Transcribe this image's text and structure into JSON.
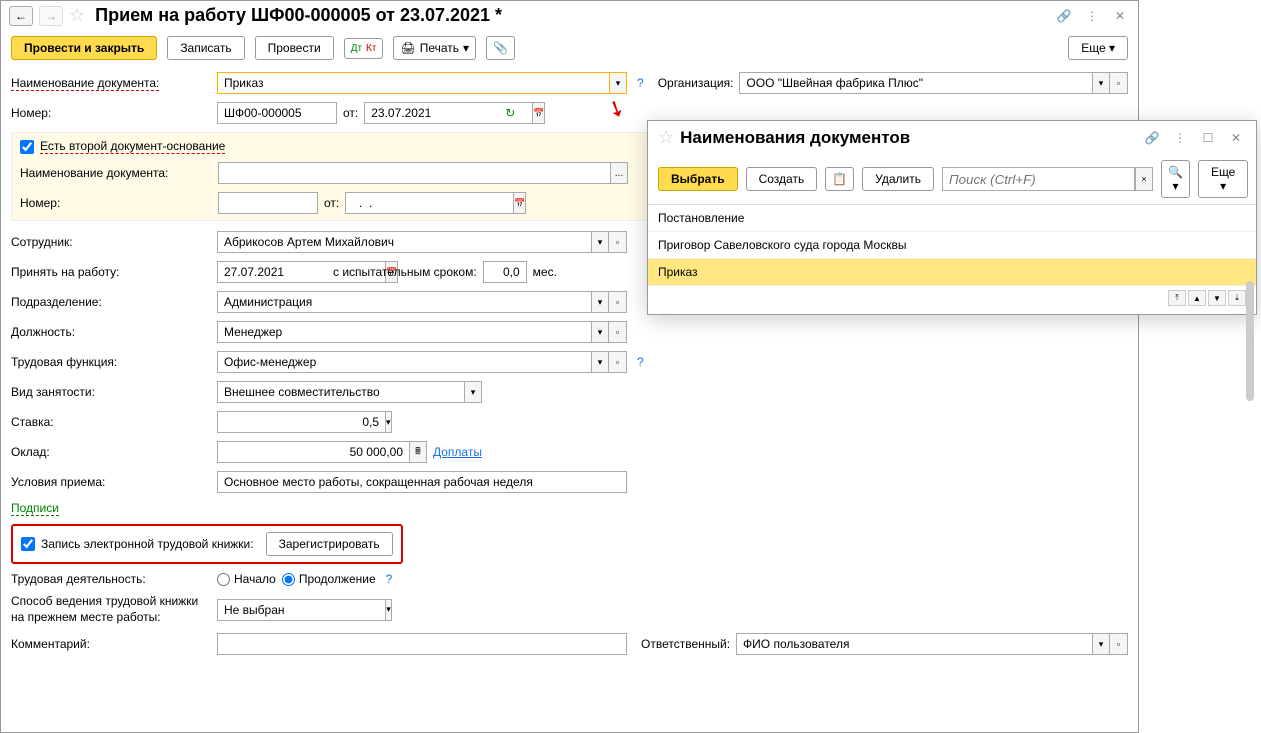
{
  "main": {
    "title": "Прием на работу ШФ00-000005 от 23.07.2021 *",
    "toolbar": {
      "post_close": "Провести и закрыть",
      "save": "Записать",
      "post": "Провести",
      "print": "Печать",
      "more": "Еще"
    },
    "labels": {
      "doc_name": "Наименование документа:",
      "number": "Номер:",
      "from": "от:",
      "org": "Организация:",
      "second_doc": "Есть второй документ-основание",
      "doc_name2": "Наименование документа:",
      "number2": "Номер:",
      "from2": "от:",
      "employee": "Сотрудник:",
      "hire_date": "Принять на работу:",
      "probation": "с испытательным сроком:",
      "months": "мес.",
      "department": "Подразделение:",
      "position": "Должность:",
      "job_function": "Трудовая функция:",
      "employment_type": "Вид занятости:",
      "rate": "Ставка:",
      "salary": "Оклад:",
      "allowances": "Доплаты",
      "conditions": "Условия приема:",
      "signatures": "Подписи",
      "etk_record": "Запись электронной трудовой книжки:",
      "register": "Зарегистрировать",
      "activity": "Трудовая деятельность:",
      "activity_start": "Начало",
      "activity_continue": "Продолжение",
      "book_method": "Способ ведения трудовой книжки на прежнем месте работы:",
      "comment": "Комментарий:",
      "responsible": "Ответственный:"
    },
    "values": {
      "doc_name": "Приказ",
      "number": "ШФ00-000005",
      "date": "23.07.2021",
      "org": "ООО \"Швейная фабрика Плюс\"",
      "doc_name2": "",
      "number2": "",
      "date2": "  .  .    ",
      "employee": "Абрикосов Артем Михайлович",
      "hire_date": "27.07.2021",
      "probation": "0,0",
      "department": "Администрация",
      "position": "Менеджер",
      "job_function": "Офис-менеджер",
      "employment_type": "Внешнее совместительство",
      "rate": "0,5",
      "salary": "50 000,00",
      "conditions": "Основное место работы, сокращенная рабочая неделя",
      "book_method": "Не выбран",
      "comment": "",
      "responsible": "ФИО пользователя"
    }
  },
  "popup": {
    "title": "Наименования документов",
    "toolbar": {
      "select": "Выбрать",
      "create": "Создать",
      "delete": "Удалить",
      "search_placeholder": "Поиск (Ctrl+F)",
      "more": "Еще"
    },
    "items": [
      "Постановление",
      "Приговор Савеловского суда города Москвы",
      "Приказ"
    ]
  }
}
